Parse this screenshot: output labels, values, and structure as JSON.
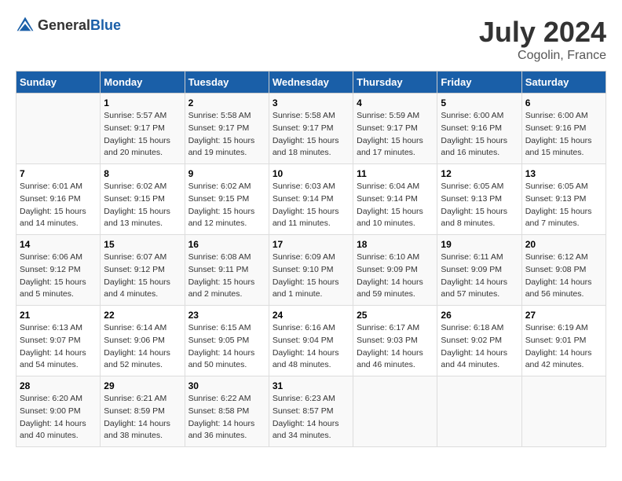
{
  "header": {
    "logo_general": "General",
    "logo_blue": "Blue",
    "month_year": "July 2024",
    "location": "Cogolin, France"
  },
  "days_of_week": [
    "Sunday",
    "Monday",
    "Tuesday",
    "Wednesday",
    "Thursday",
    "Friday",
    "Saturday"
  ],
  "weeks": [
    [
      {
        "day": "",
        "sunrise": "",
        "sunset": "",
        "daylight": ""
      },
      {
        "day": "1",
        "sunrise": "Sunrise: 5:57 AM",
        "sunset": "Sunset: 9:17 PM",
        "daylight": "Daylight: 15 hours and 20 minutes."
      },
      {
        "day": "2",
        "sunrise": "Sunrise: 5:58 AM",
        "sunset": "Sunset: 9:17 PM",
        "daylight": "Daylight: 15 hours and 19 minutes."
      },
      {
        "day": "3",
        "sunrise": "Sunrise: 5:58 AM",
        "sunset": "Sunset: 9:17 PM",
        "daylight": "Daylight: 15 hours and 18 minutes."
      },
      {
        "day": "4",
        "sunrise": "Sunrise: 5:59 AM",
        "sunset": "Sunset: 9:17 PM",
        "daylight": "Daylight: 15 hours and 17 minutes."
      },
      {
        "day": "5",
        "sunrise": "Sunrise: 6:00 AM",
        "sunset": "Sunset: 9:16 PM",
        "daylight": "Daylight: 15 hours and 16 minutes."
      },
      {
        "day": "6",
        "sunrise": "Sunrise: 6:00 AM",
        "sunset": "Sunset: 9:16 PM",
        "daylight": "Daylight: 15 hours and 15 minutes."
      }
    ],
    [
      {
        "day": "7",
        "sunrise": "Sunrise: 6:01 AM",
        "sunset": "Sunset: 9:16 PM",
        "daylight": "Daylight: 15 hours and 14 minutes."
      },
      {
        "day": "8",
        "sunrise": "Sunrise: 6:02 AM",
        "sunset": "Sunset: 9:15 PM",
        "daylight": "Daylight: 15 hours and 13 minutes."
      },
      {
        "day": "9",
        "sunrise": "Sunrise: 6:02 AM",
        "sunset": "Sunset: 9:15 PM",
        "daylight": "Daylight: 15 hours and 12 minutes."
      },
      {
        "day": "10",
        "sunrise": "Sunrise: 6:03 AM",
        "sunset": "Sunset: 9:14 PM",
        "daylight": "Daylight: 15 hours and 11 minutes."
      },
      {
        "day": "11",
        "sunrise": "Sunrise: 6:04 AM",
        "sunset": "Sunset: 9:14 PM",
        "daylight": "Daylight: 15 hours and 10 minutes."
      },
      {
        "day": "12",
        "sunrise": "Sunrise: 6:05 AM",
        "sunset": "Sunset: 9:13 PM",
        "daylight": "Daylight: 15 hours and 8 minutes."
      },
      {
        "day": "13",
        "sunrise": "Sunrise: 6:05 AM",
        "sunset": "Sunset: 9:13 PM",
        "daylight": "Daylight: 15 hours and 7 minutes."
      }
    ],
    [
      {
        "day": "14",
        "sunrise": "Sunrise: 6:06 AM",
        "sunset": "Sunset: 9:12 PM",
        "daylight": "Daylight: 15 hours and 5 minutes."
      },
      {
        "day": "15",
        "sunrise": "Sunrise: 6:07 AM",
        "sunset": "Sunset: 9:12 PM",
        "daylight": "Daylight: 15 hours and 4 minutes."
      },
      {
        "day": "16",
        "sunrise": "Sunrise: 6:08 AM",
        "sunset": "Sunset: 9:11 PM",
        "daylight": "Daylight: 15 hours and 2 minutes."
      },
      {
        "day": "17",
        "sunrise": "Sunrise: 6:09 AM",
        "sunset": "Sunset: 9:10 PM",
        "daylight": "Daylight: 15 hours and 1 minute."
      },
      {
        "day": "18",
        "sunrise": "Sunrise: 6:10 AM",
        "sunset": "Sunset: 9:09 PM",
        "daylight": "Daylight: 14 hours and 59 minutes."
      },
      {
        "day": "19",
        "sunrise": "Sunrise: 6:11 AM",
        "sunset": "Sunset: 9:09 PM",
        "daylight": "Daylight: 14 hours and 57 minutes."
      },
      {
        "day": "20",
        "sunrise": "Sunrise: 6:12 AM",
        "sunset": "Sunset: 9:08 PM",
        "daylight": "Daylight: 14 hours and 56 minutes."
      }
    ],
    [
      {
        "day": "21",
        "sunrise": "Sunrise: 6:13 AM",
        "sunset": "Sunset: 9:07 PM",
        "daylight": "Daylight: 14 hours and 54 minutes."
      },
      {
        "day": "22",
        "sunrise": "Sunrise: 6:14 AM",
        "sunset": "Sunset: 9:06 PM",
        "daylight": "Daylight: 14 hours and 52 minutes."
      },
      {
        "day": "23",
        "sunrise": "Sunrise: 6:15 AM",
        "sunset": "Sunset: 9:05 PM",
        "daylight": "Daylight: 14 hours and 50 minutes."
      },
      {
        "day": "24",
        "sunrise": "Sunrise: 6:16 AM",
        "sunset": "Sunset: 9:04 PM",
        "daylight": "Daylight: 14 hours and 48 minutes."
      },
      {
        "day": "25",
        "sunrise": "Sunrise: 6:17 AM",
        "sunset": "Sunset: 9:03 PM",
        "daylight": "Daylight: 14 hours and 46 minutes."
      },
      {
        "day": "26",
        "sunrise": "Sunrise: 6:18 AM",
        "sunset": "Sunset: 9:02 PM",
        "daylight": "Daylight: 14 hours and 44 minutes."
      },
      {
        "day": "27",
        "sunrise": "Sunrise: 6:19 AM",
        "sunset": "Sunset: 9:01 PM",
        "daylight": "Daylight: 14 hours and 42 minutes."
      }
    ],
    [
      {
        "day": "28",
        "sunrise": "Sunrise: 6:20 AM",
        "sunset": "Sunset: 9:00 PM",
        "daylight": "Daylight: 14 hours and 40 minutes."
      },
      {
        "day": "29",
        "sunrise": "Sunrise: 6:21 AM",
        "sunset": "Sunset: 8:59 PM",
        "daylight": "Daylight: 14 hours and 38 minutes."
      },
      {
        "day": "30",
        "sunrise": "Sunrise: 6:22 AM",
        "sunset": "Sunset: 8:58 PM",
        "daylight": "Daylight: 14 hours and 36 minutes."
      },
      {
        "day": "31",
        "sunrise": "Sunrise: 6:23 AM",
        "sunset": "Sunset: 8:57 PM",
        "daylight": "Daylight: 14 hours and 34 minutes."
      },
      {
        "day": "",
        "sunrise": "",
        "sunset": "",
        "daylight": ""
      },
      {
        "day": "",
        "sunrise": "",
        "sunset": "",
        "daylight": ""
      },
      {
        "day": "",
        "sunrise": "",
        "sunset": "",
        "daylight": ""
      }
    ]
  ]
}
